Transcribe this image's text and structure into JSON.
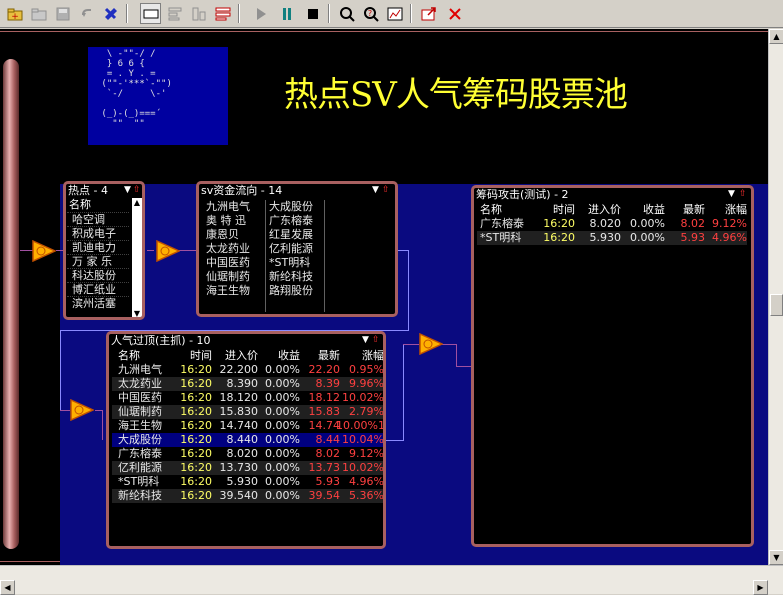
{
  "toolbar": {
    "buttons": [
      {
        "icon": "open-folder-icon"
      },
      {
        "icon": "folder-icon"
      },
      {
        "icon": "save-icon"
      },
      {
        "icon": "undo-icon"
      },
      {
        "icon": "tools-icon"
      },
      {
        "icon": "rectangle-icon"
      },
      {
        "icon": "align-left-icon"
      },
      {
        "icon": "align-bottom-icon"
      },
      {
        "icon": "list-icon"
      },
      {
        "icon": "play-icon"
      },
      {
        "icon": "pause-icon"
      },
      {
        "icon": "stop-icon"
      },
      {
        "icon": "search-icon"
      },
      {
        "icon": "zoom-icon"
      },
      {
        "icon": "chart-icon"
      },
      {
        "icon": "export-icon"
      },
      {
        "icon": "close-icon"
      }
    ]
  },
  "colors": {
    "accent": "#ffff33",
    "up": "#ff4040",
    "panel_border": "#a86060",
    "canvas_bg": "#000000",
    "blue_bg": "#0a0a80"
  },
  "ascii_art": "  \\ -\"\"-/ /\n  } 6 6 {\n  = . Y . =\n (\"\"-'***`-\"\")\n  `-/     \\-'\n\n (_)-(_)===´\n   \"\"  \"\"",
  "title": "热点SV人气筹码股票池",
  "panel_hot": {
    "title": "热点",
    "count": "- 4",
    "header": "名称",
    "items": [
      "哈空调",
      "积成电子",
      "凯迪电力",
      "万 家 乐",
      "科达股份",
      "博汇纸业",
      "滨州活塞"
    ]
  },
  "panel_sv": {
    "title": "sv资金流向",
    "count": "- 14",
    "col1": [
      "九洲电气",
      "奥 特 迅",
      "康恩贝",
      "太龙药业",
      "中国医药",
      "仙琚制药",
      "海王生物"
    ],
    "col2": [
      "大成股份",
      "广东榕泰",
      "红星发展",
      "亿利能源",
      "*ST明科",
      "新纶科技",
      "路翔股份"
    ]
  },
  "panel_attack": {
    "title": "筹码攻击(测试)",
    "count": "- 2",
    "headers": [
      "名称",
      "时间",
      "进入价",
      "收益",
      "最新",
      "涨幅"
    ],
    "rows": [
      [
        "广东榕泰",
        "16:20",
        "8.020",
        "0.00%",
        "8.02",
        "9.12%"
      ],
      [
        "*ST明科",
        "16:20",
        "5.930",
        "0.00%",
        "5.93",
        "4.96%"
      ]
    ]
  },
  "panel_popular": {
    "title": "人气过顶(主抓)",
    "count": "- 10",
    "headers": [
      "名称",
      "时间",
      "进入价",
      "收益",
      "最新",
      "涨幅"
    ],
    "rows": [
      [
        "九洲电气",
        "16:20",
        "22.200",
        "0.00%",
        "22.20",
        "0.95%"
      ],
      [
        "太龙药业",
        "16:20",
        "8.390",
        "0.00%",
        "8.39",
        "9.96%"
      ],
      [
        "中国医药",
        "16:20",
        "18.120",
        "0.00%",
        "18.12",
        "10.02%"
      ],
      [
        "仙琚制药",
        "16:20",
        "15.830",
        "0.00%",
        "15.83",
        "2.79%"
      ],
      [
        "海王生物",
        "16:20",
        "14.740",
        "0.00%",
        "14.74",
        "10.00%1"
      ],
      [
        "大成股份",
        "16:20",
        "8.440",
        "0.00%",
        "8.44",
        "10.04%"
      ],
      [
        "广东榕泰",
        "16:20",
        "8.020",
        "0.00%",
        "8.02",
        "9.12%"
      ],
      [
        "亿利能源",
        "16:20",
        "13.730",
        "0.00%",
        "13.73",
        "10.02%"
      ],
      [
        "*ST明科",
        "16:20",
        "5.930",
        "0.00%",
        "5.93",
        "4.96%"
      ],
      [
        "新纶科技",
        "16:20",
        "39.540",
        "0.00%",
        "39.54",
        "5.36%"
      ]
    ],
    "selected_index": 5
  }
}
